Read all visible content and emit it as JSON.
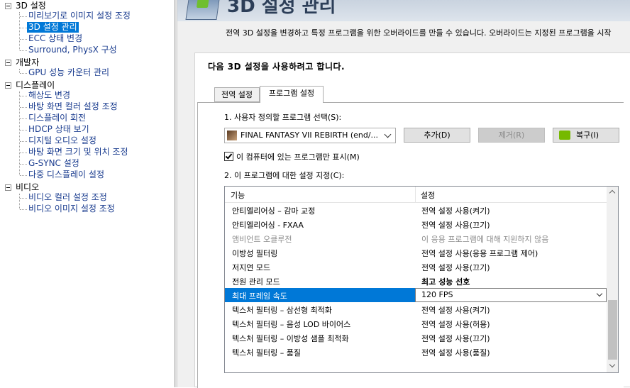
{
  "tree": {
    "groups": [
      {
        "label": "3D 설정",
        "items": [
          {
            "label": "미리보기로 이미지 설정 조정"
          },
          {
            "label": "3D 설정 관리",
            "selected": true
          },
          {
            "label": "ECC 상태 변경"
          },
          {
            "label": "Surround, PhysX 구성"
          }
        ]
      },
      {
        "label": "개발자",
        "items": [
          {
            "label": "GPU 성능 카운터 관리"
          }
        ]
      },
      {
        "label": "디스플레이",
        "items": [
          {
            "label": "해상도 변경"
          },
          {
            "label": "바탕 화면 컬러 설정 조정"
          },
          {
            "label": "디스플레이 회전"
          },
          {
            "label": "HDCP 상태 보기"
          },
          {
            "label": "디지털 오디오 설정"
          },
          {
            "label": "바탕 화면 크기 및 위치 조정"
          },
          {
            "label": "G-SYNC 설정"
          },
          {
            "label": "다중 디스플레이 설정"
          }
        ]
      },
      {
        "label": "비디오",
        "items": [
          {
            "label": "비디오 컬러 설정 조정"
          },
          {
            "label": "비디오 이미지 설정 조정"
          }
        ]
      }
    ]
  },
  "header": {
    "title": "3D 설정 관리",
    "icon": "3d-settings-icon",
    "description": "전역 3D 설정을 변경하고 특정 프로그램을 위한 오버라이드를 만들 수 있습니다. 오버라이드는 지정된 프로그램을 시작"
  },
  "panel": {
    "title": "다음 3D 설정을 사용하려고 합니다.",
    "tabs": [
      {
        "label": "전역 설정"
      },
      {
        "label": "프로그램 설정",
        "active": true
      }
    ],
    "step1_label": "1. 사용자 정의할 프로그램 선택(S):",
    "program_selected": "FINAL FANTASY VII REBIRTH (end/...",
    "add_button": "추가(D)",
    "remove_button": "제거(R)",
    "restore_button": "복구(I)",
    "show_only_installed": "이 컴퓨터에 있는 프로그램만 표시(M)",
    "show_only_installed_checked": true,
    "step2_label": "2. 이 프로그램에 대한 설정 지정(C):",
    "grid": {
      "col_feature": "기능",
      "col_setting": "설정",
      "rows": [
        {
          "feature": "안티엘리어싱 – 감마 교정",
          "setting": "전역 설정 사용(켜기)"
        },
        {
          "feature": "안티엘리어싱 - FXAA",
          "setting": "전역 설정 사용(끄기)"
        },
        {
          "feature": "앰비언트 오클루전",
          "setting": "이 응용 프로그램에 대해 지원하지 않음",
          "disabled": true
        },
        {
          "feature": "이방성 필터링",
          "setting": "전역 설정 사용(응용 프로그램 제어)"
        },
        {
          "feature": "저지연 모드",
          "setting": "전역 설정 사용(끄기)"
        },
        {
          "feature": "전원 관리 모드",
          "setting": "최고 성능 선호",
          "bold": true
        },
        {
          "feature": "최대 프레임 속도",
          "setting": "120 FPS",
          "selected": true
        },
        {
          "feature": "텍스처 필터링 – 삼선형 최적화",
          "setting": "전역 설정 사용(켜기)"
        },
        {
          "feature": "텍스처 필터링 – 음성 LOD 바이어스",
          "setting": "전역 설정 사용(허용)"
        },
        {
          "feature": "텍스처 필터링 – 이방성 샘플 최적화",
          "setting": "전역 설정 사용(끄기)"
        },
        {
          "feature": "텍스처 필터링 – 품질",
          "setting": "전역 설정 사용(품질)"
        }
      ]
    }
  },
  "colors": {
    "selection": "#0078d7",
    "nvidia_green": "#76b900",
    "tree_child_text": "#1a3c8f"
  }
}
